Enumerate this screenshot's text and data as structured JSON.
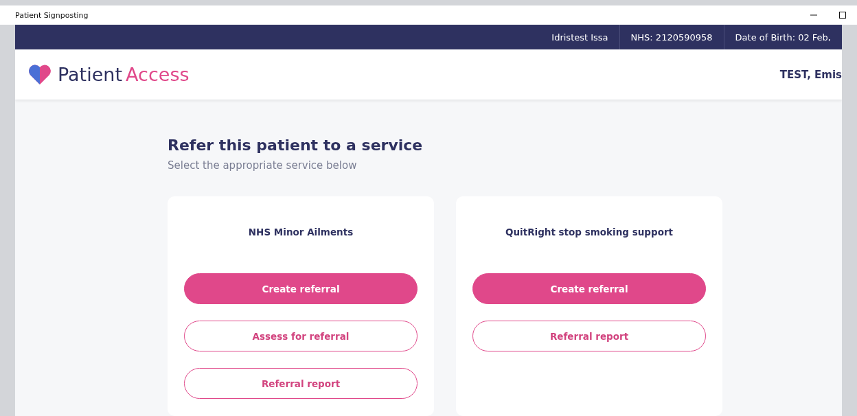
{
  "window": {
    "title": "Patient Signposting"
  },
  "patient_bar": [
    {
      "label": "Idristest Issa"
    },
    {
      "label": "NHS: 2120590958"
    },
    {
      "label": "Date of Birth: 02 Feb,"
    }
  ],
  "header": {
    "logo_primary": "Patient",
    "logo_secondary": "Access",
    "user": "TEST, Emis"
  },
  "page": {
    "title": "Refer this patient to a service",
    "subtitle": "Select the appropriate service below"
  },
  "services": [
    {
      "name": "NHS Minor Ailments",
      "buttons": [
        {
          "label": "Create referral",
          "kind": "primary"
        },
        {
          "label": "Assess for referral",
          "kind": "outline"
        },
        {
          "label": "Referral report",
          "kind": "outline"
        }
      ]
    },
    {
      "name": "QuitRight stop smoking support",
      "buttons": [
        {
          "label": "Create referral",
          "kind": "primary"
        },
        {
          "label": "Referral report",
          "kind": "outline"
        }
      ]
    }
  ]
}
